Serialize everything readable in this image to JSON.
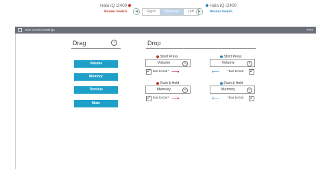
{
  "device_left": {
    "name": "Halo iQ i2400",
    "sub": "Rocker Switch"
  },
  "device_right": {
    "name": "Halo iQ i2400",
    "sub": "Rocker Switch"
  },
  "ear_toggle": {
    "options": [
      "Right",
      "Binaural",
      "Left"
    ],
    "selected": "Binaural"
  },
  "window": {
    "title": "User Control Settings",
    "right_text": "Prev"
  },
  "drag": {
    "heading": "Drag",
    "items": [
      "Volume",
      "Memory",
      "Tinnitus",
      "Mute"
    ]
  },
  "drop": {
    "heading": "Drop",
    "left": {
      "short_press": {
        "label": "Short Press",
        "value": "Volume",
        "option": "Ear to Ear*"
      },
      "push_hold": {
        "label": "Push & Hold",
        "value": "Memory",
        "option": "Ear to Ear*"
      }
    },
    "right": {
      "short_press": {
        "label": "Short Press",
        "value": "Volume",
        "option": "*Ear to Ear"
      },
      "push_hold": {
        "label": "Push & Hold",
        "value": "Memory",
        "option": "*Ear to Ear"
      }
    }
  },
  "colors": {
    "accent": "#1ea0c8",
    "left_ear": "#c0392b",
    "right_ear": "#2e86c1",
    "titlebar": "#6b6f77"
  },
  "icons": {
    "clear": "circle-x-icon",
    "info": "info-icon",
    "check": "check-icon"
  }
}
